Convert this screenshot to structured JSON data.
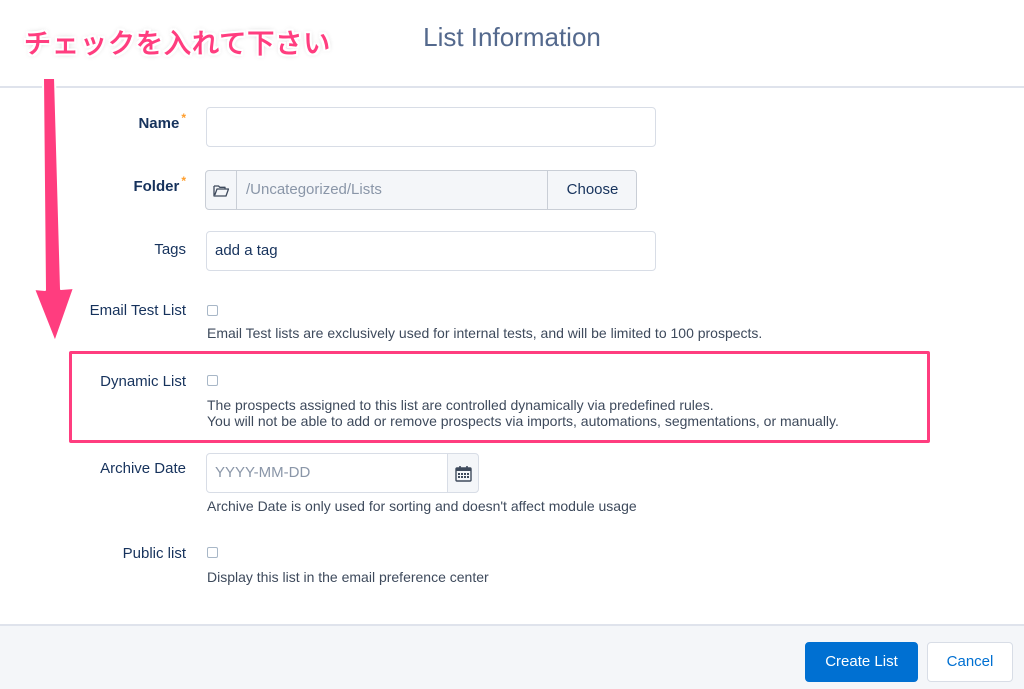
{
  "modal": {
    "title": "List Information"
  },
  "annotation": {
    "text": "チェックを入れて下さい",
    "color": "#ff3d7f"
  },
  "form": {
    "name": {
      "label": "Name",
      "required_mark": "*",
      "value": ""
    },
    "folder": {
      "label": "Folder",
      "required_mark": "*",
      "icon": "folder-open-icon",
      "path": "/Uncategorized/Lists",
      "button_label": "Choose"
    },
    "tags": {
      "label": "Tags",
      "value": "add a tag"
    },
    "email_test_list": {
      "label": "Email Test List",
      "checked": false,
      "help": "Email Test lists are exclusively used for internal tests, and will be limited to 100 prospects."
    },
    "dynamic_list": {
      "label": "Dynamic List",
      "checked": false,
      "help_line1": "The prospects assigned to this list are controlled dynamically via predefined rules.",
      "help_line2": "You will not be able to add or remove prospects via imports, automations, segmentations, or manually."
    },
    "archive_date": {
      "label": "Archive Date",
      "placeholder": "YYYY-MM-DD",
      "icon": "calendar-icon",
      "help": "Archive Date is only used for sorting and doesn't affect module usage"
    },
    "public_list": {
      "label": "Public list",
      "checked": false,
      "help": "Display this list in the email preference center"
    }
  },
  "footer": {
    "create_label": "Create List",
    "cancel_label": "Cancel"
  },
  "colors": {
    "primary": "#0070d2",
    "required": "#ff9e2c",
    "highlight": "#ff3d7f"
  }
}
